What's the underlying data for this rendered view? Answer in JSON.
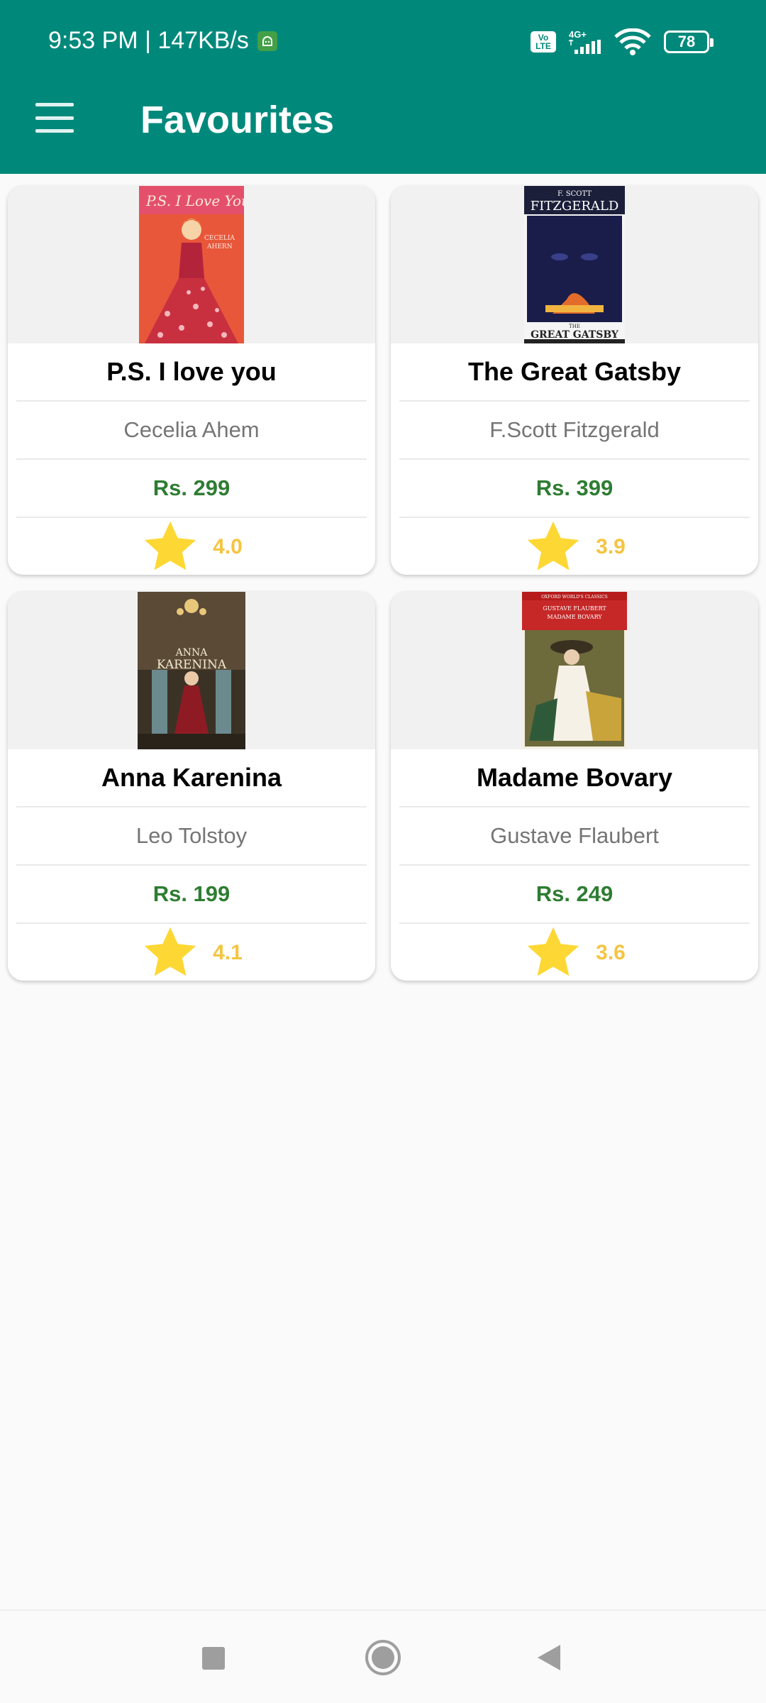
{
  "status_bar": {
    "time_speed": "9:53 PM | 147KB/s",
    "volte": "Vo LTE",
    "network": "4G+",
    "battery": "78"
  },
  "app_bar": {
    "title": "Favourites",
    "menu_icon": "hamburger-menu-icon"
  },
  "books": [
    {
      "title": "P.S. I love you",
      "author": "Cecelia Ahem",
      "price": "Rs. 299",
      "rating": "4.0"
    },
    {
      "title": "The Great Gatsby",
      "author": "F.Scott Fitzgerald",
      "price": "Rs. 399",
      "rating": "3.9"
    },
    {
      "title": "Anna Karenina",
      "author": "Leo Tolstoy",
      "price": "Rs. 199",
      "rating": "4.1"
    },
    {
      "title": "Madame Bovary",
      "author": "Gustave Flaubert",
      "price": "Rs. 249",
      "rating": "3.6"
    }
  ],
  "covers": {
    "ps": {
      "line1": "P.S. I Love You",
      "line2": "CECELIA",
      "line3": "AHERN"
    },
    "gatsby": {
      "top1": "F. SCOTT",
      "top2": "FITZGERALD",
      "bottom1": "THE",
      "bottom2": "GREAT GATSBY"
    },
    "anna": {
      "line1": "ANNA",
      "line2": "KARENINA"
    },
    "bovary": {
      "top": "OXFORD WORLD'S CLASSICS",
      "line1": "GUSTAVE FLAUBERT",
      "line2": "MADAME BOVARY"
    }
  },
  "colors": {
    "app_bar": "#00897b",
    "price": "#2e7d32",
    "rating": "#f4c542"
  },
  "nav": {
    "recents_icon": "square-recents-icon",
    "home_icon": "circle-home-icon",
    "back_icon": "triangle-back-icon"
  }
}
